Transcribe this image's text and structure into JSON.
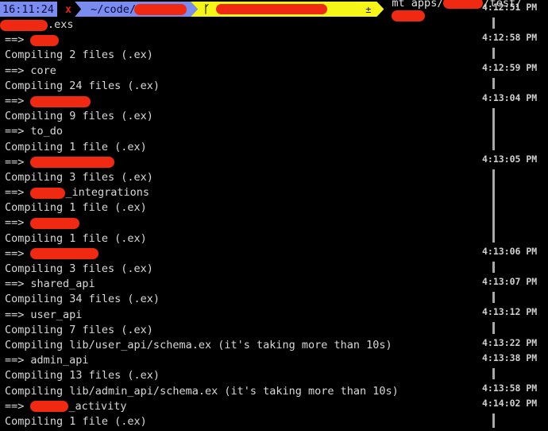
{
  "prompt": {
    "time": "16:11:24",
    "status_icon": "x",
    "dir_prefix": "~/code/",
    "git_icon": "git-branch-icon",
    "git_dirty": "±",
    "command_prefix": "mt apps/",
    "command_mid": "/test/",
    "colors": {
      "time_bg": "#7b8cf0",
      "status_fg": "#e5261a",
      "git_bg": "#f5f518",
      "redaction": "#f02a12"
    }
  },
  "lines": [
    {
      "kind": "text",
      "pre_redacted": true,
      "text": ".exs"
    },
    {
      "kind": "app",
      "arrow": "==>",
      "redacted": true,
      "text": ""
    },
    {
      "kind": "text",
      "text": "Compiling 2 files (.ex)"
    },
    {
      "kind": "app",
      "arrow": "==>",
      "text": "core"
    },
    {
      "kind": "text",
      "text": "Compiling 24 files (.ex)"
    },
    {
      "kind": "app",
      "arrow": "==>",
      "redacted": true,
      "text": ""
    },
    {
      "kind": "text",
      "text": "Compiling 9 files (.ex)"
    },
    {
      "kind": "app",
      "arrow": "==>",
      "text": "to_do"
    },
    {
      "kind": "text",
      "text": "Compiling 1 file (.ex)"
    },
    {
      "kind": "app",
      "arrow": "==>",
      "redacted": true,
      "text": ""
    },
    {
      "kind": "text",
      "text": "Compiling 3 files (.ex)"
    },
    {
      "kind": "app",
      "arrow": "==>",
      "redacted": true,
      "text": "_integrations"
    },
    {
      "kind": "text",
      "text": "Compiling 1 file (.ex)"
    },
    {
      "kind": "app",
      "arrow": "==>",
      "redacted": true,
      "text": ""
    },
    {
      "kind": "text",
      "text": "Compiling 1 file (.ex)"
    },
    {
      "kind": "app",
      "arrow": "==>",
      "redacted": true,
      "text": ""
    },
    {
      "kind": "text",
      "text": "Compiling 3 files (.ex)"
    },
    {
      "kind": "app",
      "arrow": "==>",
      "text": "shared_api"
    },
    {
      "kind": "text",
      "text": "Compiling 34 files (.ex)"
    },
    {
      "kind": "app",
      "arrow": "==>",
      "text": "user_api"
    },
    {
      "kind": "text",
      "text": "Compiling 7 files (.ex)"
    },
    {
      "kind": "text",
      "text": "Compiling lib/user_api/schema.ex (it's taking more than 10s)"
    },
    {
      "kind": "app",
      "arrow": "==>",
      "text": "admin_api"
    },
    {
      "kind": "text",
      "text": "Compiling 13 files (.ex)"
    },
    {
      "kind": "text",
      "text": "Compiling lib/admin_api/schema.ex (it's taking more than 10s)"
    },
    {
      "kind": "app",
      "arrow": "==>",
      "redacted": true,
      "text": "_activity"
    },
    {
      "kind": "text",
      "text": "Compiling 1 file (.ex)"
    }
  ],
  "timestamps": [
    "4:12:51 PM",
    "4:12:58 PM",
    "4:12:59 PM",
    "4:13:04 PM",
    "4:13:05 PM",
    "4:13:06 PM",
    "4:13:07 PM",
    "4:13:12 PM",
    "4:13:22 PM",
    "4:13:38 PM",
    "4:13:58 PM",
    "4:14:02 PM"
  ]
}
